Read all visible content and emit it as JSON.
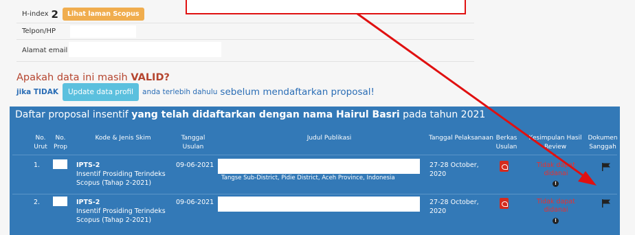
{
  "profile": {
    "hindex_label": "H-index",
    "hindex_value": "2",
    "scopus_link": "Lihat laman Scopus",
    "phone_label": "Telpon/HP",
    "email_label": "Alamat email"
  },
  "validation": {
    "question_prefix": "Apakah data ini masih",
    "question_strong": "VALID?",
    "if_label": "jika TIDAK",
    "update_button": "Update data profil",
    "middle_text": "anda terlebih dahulu",
    "end_text": "sebelum mendaftarkan proposal!"
  },
  "panel": {
    "title_1": "Daftar proposal insentif",
    "title_2": "yang telah didaftarkan dengan nama Hairul Basri",
    "title_3": "pada tahun 2021",
    "headers": [
      "No. Urut",
      "No. Prop",
      "Kode & Jenis Skim",
      "Tanggal Usulan",
      "Judul Publikasi",
      "Tanggal Pelaksanaan",
      "Berkas Usulan",
      "Kesimpulan Hasil Review",
      "Dokumen Sanggah"
    ],
    "rows": [
      {
        "no": "1.",
        "kode": "IPTS-2",
        "skim": "Insentif Prosiding Terindeks Scopus (Tahap 2-2021)",
        "tanggal": "09-06-2021",
        "judul_partial": "Tangse Sub-District, Pidie District, Aceh Province, Indonesia",
        "pelaksanaan": "27-28 October, 2020",
        "status": "Tidak dapat didanai"
      },
      {
        "no": "2.",
        "kode": "IPTS-2",
        "skim": "Insentif Prosiding Terindeks Scopus (Tahap 2-2021)",
        "tanggal": "09-06-2021",
        "judul_partial": "",
        "pelaksanaan": "27-28 October, 2020",
        "status": "Tidak dapat didanai"
      }
    ]
  },
  "colors": {
    "panel_bg": "#3379b7",
    "annotation": "#e01010",
    "badge": "#f0ad4e",
    "button": "#5bc0de"
  }
}
